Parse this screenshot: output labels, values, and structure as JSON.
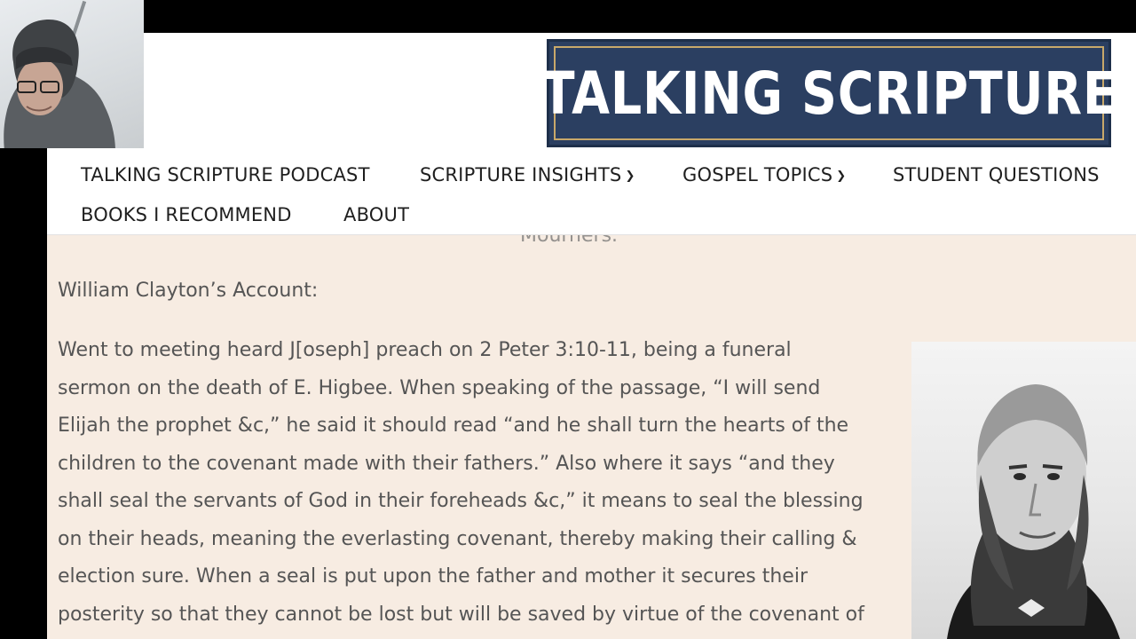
{
  "logo": {
    "text": "TALKING SCRIPTURE"
  },
  "nav": {
    "items": [
      {
        "label": "TALKING SCRIPTURE PODCAST",
        "dropdown": false
      },
      {
        "label": "SCRIPTURE INSIGHTS",
        "dropdown": true
      },
      {
        "label": "GOSPEL TOPICS",
        "dropdown": true
      },
      {
        "label": "STUDENT QUESTIONS",
        "dropdown": false
      },
      {
        "label": "BOOKS I RECOMMEND",
        "dropdown": false
      },
      {
        "label": "ABOUT",
        "dropdown": false
      }
    ]
  },
  "content": {
    "cut_text": "Mourners.",
    "heading": "William Clayton’s Account:",
    "quote_lines": [
      "Went to meeting heard J[oseph] preach on 2 Peter 3:10-11, being a funeral",
      "sermon on the death of E. Higbee. When speaking of the passage, “I will send",
      "Elijah the prophet &c,” he said it should read “and he shall turn the hearts of the",
      "children to the covenant made with their fathers.” Also where it says “and they",
      "shall seal the servants of God in their foreheads &c,” it means to seal the blessing",
      "on their heads, meaning the everlasting covenant, thereby making their calling &",
      "election sure. When a seal is put upon the father and mother it secures their",
      "posterity so that they cannot be lost but will be saved by virtue of the covenant of"
    ]
  },
  "colors": {
    "logo_bg": "#2b3f61",
    "logo_border": "#c8a86a",
    "content_bg": "#f7ece2",
    "text": "#555555"
  },
  "icons": {
    "dropdown": "chevron-down-icon"
  }
}
